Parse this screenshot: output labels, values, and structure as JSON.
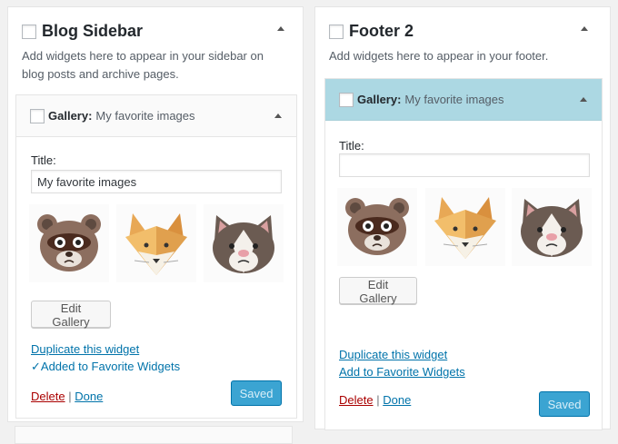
{
  "left_area": {
    "title": "Blog Sidebar",
    "description": "Add widgets here to appear in your sidebar on blog posts and archive pages.",
    "widget": {
      "name": "Gallery:",
      "subtitle": "My favorite images",
      "title_label": "Title:",
      "title_value": "My favorite images",
      "images": [
        "raccoon",
        "fox",
        "cat"
      ],
      "edit_gallery_label": "Edit Gallery",
      "duplicate_label": "Duplicate this widget",
      "favorite_label": "✓Added to Favorite Widgets",
      "delete_label": "Delete",
      "separator": "|",
      "done_label": "Done",
      "saved_label": "Saved"
    }
  },
  "right_area": {
    "title": "Footer 2",
    "description": "Add widgets here to appear in your footer.",
    "widget": {
      "name": "Gallery:",
      "subtitle": "My favorite images",
      "title_label": "Title:",
      "title_value": "",
      "images": [
        "raccoon",
        "fox",
        "cat"
      ],
      "edit_gallery_label": "Edit Gallery",
      "duplicate_label": "Duplicate this widget",
      "favorite_label": "Add to Favorite Widgets",
      "delete_label": "Delete",
      "separator": "|",
      "done_label": "Done",
      "saved_label": "Saved"
    }
  },
  "colors": {
    "link": "#0073aa",
    "delete": "#aa0000",
    "primary_button": "#3ba4d2",
    "active_widget_header": "#acd8e3"
  }
}
